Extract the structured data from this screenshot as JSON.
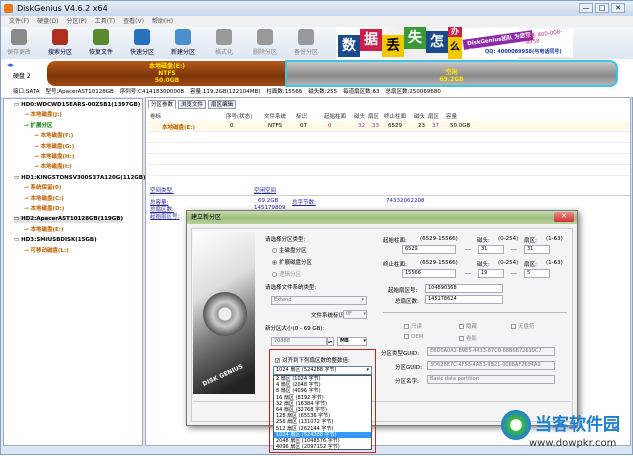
{
  "window": {
    "title": "DiskGenius V4.6.2 x64",
    "controls": [
      "—",
      "□",
      "✕"
    ]
  },
  "menu": [
    "文件(F)",
    "硬盘(D)",
    "分区(P)",
    "工具(T)",
    "查看(V)",
    "帮助(H)"
  ],
  "toolbar": [
    {
      "label": "保存更改",
      "icon": "save-icon",
      "enabled": false,
      "color": "#8a8a8a"
    },
    {
      "label": "搜索分区",
      "icon": "search-icon",
      "enabled": true,
      "color": "#b03020"
    },
    {
      "label": "恢复文件",
      "icon": "recover-file-icon",
      "enabled": true,
      "color": "#5a8a30"
    },
    {
      "label": "快速分区",
      "icon": "quick-partition-icon",
      "enabled": true,
      "color": "#2a70c0"
    },
    {
      "label": "新建分区",
      "icon": "new-partition-icon",
      "enabled": true,
      "color": "#4a90d0"
    },
    {
      "label": "格式化",
      "icon": "format-icon",
      "enabled": false,
      "color": "#999999"
    },
    {
      "label": "删除分区",
      "icon": "delete-partition-icon",
      "enabled": false,
      "color": "#999999"
    },
    {
      "label": "备份分区",
      "icon": "backup-partition-icon",
      "enabled": false,
      "color": "#999999"
    }
  ],
  "banner": {
    "tiles": [
      "数",
      "据",
      "丢",
      "失",
      "怎",
      "么",
      "办"
    ],
    "slogan": "DiskGenius团队 为您服务",
    "phone": "电话 400-008-9958",
    "qq": "QQ: 4000089958(与电话同号)"
  },
  "disk": {
    "label": "硬盘 2",
    "partitions": [
      {
        "name": "本地磁盘(E:)",
        "fs": "NTFS",
        "size": "50.0GB"
      },
      {
        "name": "空闲",
        "size": "69.2GB"
      }
    ],
    "info": [
      "接口:SATA",
      "型号:ApacerAST10128GB",
      "序列号:C414183000008",
      "容量:119.2GB(122104MB)",
      "柱面数:15566",
      "磁头数:255",
      "每道扇区数:63",
      "总扇区数:250069680"
    ]
  },
  "tree": [
    {
      "text": "HD0:WDCWD15EARS-00Z5B1(1397GB)",
      "type": "disk"
    },
    {
      "text": "本地磁盘(J:)",
      "type": "part"
    },
    {
      "text": "扩展分区",
      "type": "ext"
    },
    {
      "text": "本地磁盘(F:)",
      "type": "part"
    },
    {
      "text": "本地磁盘(G:)",
      "type": "part"
    },
    {
      "text": "本地磁盘(H:)",
      "type": "part"
    },
    {
      "text": "本地磁盘(I:)",
      "type": "part"
    },
    {
      "text": "HD1:KINGSTONSV300S37A120G(112GB)",
      "type": "disk"
    },
    {
      "text": "系统保留(0)",
      "type": "part"
    },
    {
      "text": "本地磁盘(C:)",
      "type": "part"
    },
    {
      "text": "本地磁盘(D:)",
      "type": "part"
    },
    {
      "text": "HD2:ApacerAST10128GB(119GB)",
      "type": "disk",
      "selected": true
    },
    {
      "text": "本地磁盘(E:)",
      "type": "part"
    },
    {
      "text": "HD3:SMIUSBDISK(15GB)",
      "type": "disk"
    },
    {
      "text": "可移动磁盘(L:)",
      "type": "part"
    }
  ],
  "tabs": [
    "分区参数",
    "浏览文件",
    "扇区编辑"
  ],
  "table": {
    "headers": [
      "卷标",
      "序号(状态)",
      "文件系统",
      "标识",
      "起始柱面",
      "磁头",
      "扇区",
      "终止柱面",
      "磁头",
      "扇区",
      "容量"
    ],
    "rows": [
      [
        "本地磁盘(E:)",
        "0",
        "NTFS",
        "07",
        "0",
        "32",
        "33",
        "6529",
        "23",
        "37",
        "50.0GB"
      ]
    ]
  },
  "details": {
    "space_type_label": "空间类型:",
    "space_type_value": "空闲空间",
    "total_label": "总容量:",
    "total_value": "69.2GB",
    "total_bytes_label": "总字节数:",
    "total_bytes_value": "74332062208",
    "sectors_label": "总扇区数:",
    "sectors_value": "145179809",
    "start_label": "起始扇区号:"
  },
  "dialog": {
    "title": "建立新分区",
    "close": "✕",
    "type_label": "请选择分区类型:",
    "types": [
      {
        "label": "主磁盘分区",
        "checked": false,
        "enabled": true
      },
      {
        "label": "扩展磁盘分区",
        "checked": true,
        "enabled": true
      },
      {
        "label": "逻辑分区",
        "checked": false,
        "enabled": false
      }
    ],
    "fs_label": "请选择文件系统类型:",
    "fs_value": "Extend",
    "fsid_label": "文件系统标识:",
    "fsid_value": "0F",
    "size_label": "新分区大小(0 - 69 GB):",
    "size_value": "70888",
    "size_unit": "MB",
    "align_label": "对齐到下列扇区数的整数倍:",
    "align_checked": true,
    "align_value": "1024 扇区 (524288 字节)",
    "align_options": [
      "2 扇区 (1024 字节)",
      "4 扇区 (2048 字节)",
      "8 扇区 (4096 字节)",
      "16 扇区 (8192 字节)",
      "32 扇区 (16384 字节)",
      "64 扇区 (32768 字节)",
      "128 扇区 (65536 字节)",
      "256 扇区 (131072 字节)",
      "512 扇区 (262144 字节)",
      "1024 扇区 (524288 字节)",
      "2048 扇区 (1048576 字节)",
      "4096 扇区 (2097152 字节)"
    ],
    "selected_option": 9,
    "start_cyl_label": "起始柱面:",
    "start_cyl_range": "(6529-15566)",
    "start_cyl": "6529",
    "head_label": "磁头:",
    "head_range": "(0-254)",
    "sector_label": "扇区:",
    "sector_range": "(1-63)",
    "start_head": "31",
    "start_sector": "31",
    "end_cyl_label": "终止柱面:",
    "end_cyl_range": "(6529-15566)",
    "end_cyl": "15566",
    "end_head": "19",
    "end_sector": "5",
    "dash": "---",
    "start_sec_label": "起始扇区号:",
    "start_sec": "104890368",
    "total_sec_label": "总扇区数:",
    "total_sec": "145178624",
    "flags": [
      "只读",
      "隐藏",
      "无盘符",
      "OEM",
      "卷影"
    ],
    "type_guid_label": "分区类型GUID:",
    "type_guid": "EBD0A0A2-B9E5-4433-87C0-68B6B72699C7",
    "guid_label": "分区GUID:",
    "guid": "3D62BE7C-4F53-4AE3-9B21-0088AF2694A9",
    "name_label": "分区名字:",
    "name": "Basic data partition",
    "image_text": "DISK GENIUS"
  },
  "watermark": {
    "brand": "当客软件园",
    "url": "www.dowpkr.com",
    "color": "#1e7fd0",
    "accent": "#3cb83c"
  }
}
